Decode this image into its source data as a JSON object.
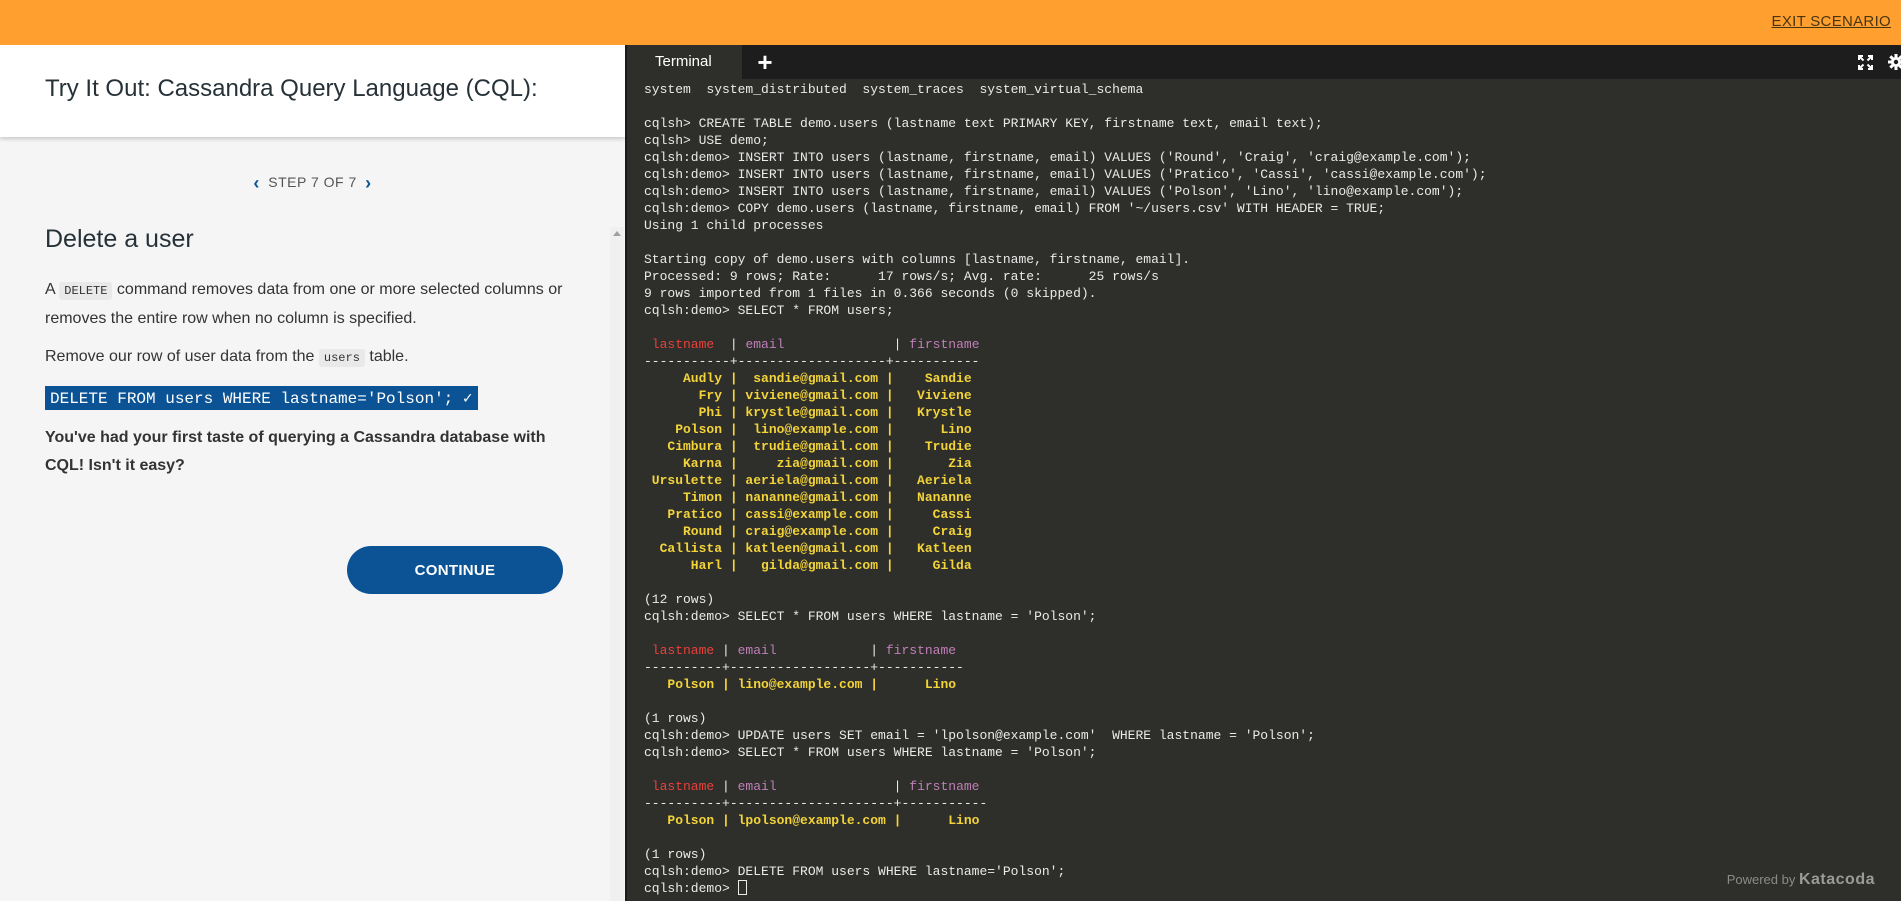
{
  "topbar": {
    "exit_label": "EXIT SCENARIO",
    "color": "#ff9f30"
  },
  "left": {
    "title": "Try It Out: Cassandra Query Language (CQL):",
    "step_label": "STEP 7 OF 7",
    "heading": "Delete a user",
    "p1_a": "A",
    "p1_code": "DELETE",
    "p1_b": "command removes data from one or more selected columns or removes the entire row when no column is specified.",
    "p2_a": "Remove our row of user data from the",
    "p2_code": "users",
    "p2_b": "table.",
    "exec_command": "DELETE FROM users WHERE lastname='Polson'; ✓",
    "closing": "You've had your first taste of querying a Cassandra database with CQL! Isn't it easy?",
    "continue_label": "CONTINUE"
  },
  "terminal": {
    "tab_label": "Terminal",
    "add_tab_label": "+",
    "lines": [
      {
        "t": "system  system_distributed  system_traces  system_virtual_schema",
        "c": ""
      },
      {
        "t": "",
        "c": ""
      },
      {
        "t": "cqlsh> CREATE TABLE demo.users (lastname text PRIMARY KEY, firstname text, email text);",
        "c": ""
      },
      {
        "t": "cqlsh> USE demo;",
        "c": ""
      },
      {
        "t": "cqlsh:demo> INSERT INTO users (lastname, firstname, email) VALUES ('Round', 'Craig', 'craig@example.com');",
        "c": ""
      },
      {
        "t": "cqlsh:demo> INSERT INTO users (lastname, firstname, email) VALUES ('Pratico', 'Cassi', 'cassi@example.com');",
        "c": ""
      },
      {
        "t": "cqlsh:demo> INSERT INTO users (lastname, firstname, email) VALUES ('Polson', 'Lino', 'lino@example.com');",
        "c": ""
      },
      {
        "t": "cqlsh:demo> COPY demo.users (lastname, firstname, email) FROM '~/users.csv' WITH HEADER = TRUE;",
        "c": ""
      },
      {
        "t": "Using 1 child processes",
        "c": ""
      },
      {
        "t": "",
        "c": ""
      },
      {
        "t": "Starting copy of demo.users with columns [lastname, firstname, email].",
        "c": ""
      },
      {
        "t": "Processed: 9 rows; Rate:      17 rows/s; Avg. rate:      25 rows/s",
        "c": ""
      },
      {
        "t": "9 rows imported from 1 files in 0.366 seconds (0 skipped).",
        "c": ""
      },
      {
        "t": "cqlsh:demo> SELECT * FROM users;",
        "c": ""
      },
      {
        "t": "",
        "c": ""
      },
      {
        "t": "",
        "c": "header",
        "cols": [
          " lastname",
          "  | ",
          "email             ",
          " | ",
          "firstname"
        ]
      },
      {
        "t": "-----------+-------------------+-----------",
        "c": ""
      },
      {
        "t": "     Audly |  sandie@gmail.com |    Sandie",
        "c": "row"
      },
      {
        "t": "       Fry | viviene@gmail.com |   Viviene",
        "c": "row"
      },
      {
        "t": "       Phi | krystle@gmail.com |   Krystle",
        "c": "row"
      },
      {
        "t": "    Polson |  lino@example.com |      Lino",
        "c": "row"
      },
      {
        "t": "   Cimbura |  trudie@gmail.com |    Trudie",
        "c": "row"
      },
      {
        "t": "     Karna |     zia@gmail.com |       Zia",
        "c": "row"
      },
      {
        "t": " Ursulette | aeriela@gmail.com |   Aeriela",
        "c": "row"
      },
      {
        "t": "     Timon | nananne@gmail.com |   Nananne",
        "c": "row"
      },
      {
        "t": "   Pratico | cassi@example.com |     Cassi",
        "c": "row"
      },
      {
        "t": "     Round | craig@example.com |     Craig",
        "c": "row"
      },
      {
        "t": "  Callista | katleen@gmail.com |   Katleen",
        "c": "row"
      },
      {
        "t": "      Harl |   gilda@gmail.com |     Gilda",
        "c": "row"
      },
      {
        "t": "",
        "c": ""
      },
      {
        "t": "(12 rows)",
        "c": ""
      },
      {
        "t": "cqlsh:demo> SELECT * FROM users WHERE lastname = 'Polson';",
        "c": ""
      },
      {
        "t": "",
        "c": ""
      },
      {
        "t": "",
        "c": "header",
        "cols": [
          " lastname",
          " | ",
          "email           ",
          " | ",
          "firstname"
        ]
      },
      {
        "t": "----------+------------------+-----------",
        "c": ""
      },
      {
        "t": "   Polson | lino@example.com |      Lino",
        "c": "row"
      },
      {
        "t": "",
        "c": ""
      },
      {
        "t": "(1 rows)",
        "c": ""
      },
      {
        "t": "cqlsh:demo> UPDATE users SET email = 'lpolson@example.com'  WHERE lastname = 'Polson';",
        "c": ""
      },
      {
        "t": "cqlsh:demo> SELECT * FROM users WHERE lastname = 'Polson';",
        "c": ""
      },
      {
        "t": "",
        "c": ""
      },
      {
        "t": "",
        "c": "header",
        "cols": [
          " lastname",
          " | ",
          "email              ",
          " | ",
          "firstname"
        ]
      },
      {
        "t": "----------+---------------------+-----------",
        "c": ""
      },
      {
        "t": "   Polson | lpolson@example.com |      Lino",
        "c": "row"
      },
      {
        "t": "",
        "c": ""
      },
      {
        "t": "(1 rows)",
        "c": ""
      },
      {
        "t": "cqlsh:demo> DELETE FROM users WHERE lastname='Polson';",
        "c": ""
      },
      {
        "t": "cqlsh:demo> ",
        "c": "prompt"
      }
    ],
    "powered_by": "Powered by",
    "brand": "Katacoda"
  },
  "icons": {
    "fullscreen": "fullscreen-icon",
    "settings": "gear-icon",
    "prev": "chevron-left-icon",
    "next": "chevron-right-icon"
  },
  "colors": {
    "accent_blue": "#0b5394",
    "terminal_bg": "#2e2e2a",
    "header_red": "#e8413c",
    "header_magenta": "#c07fb8",
    "value_yellow": "#f2d33a"
  }
}
